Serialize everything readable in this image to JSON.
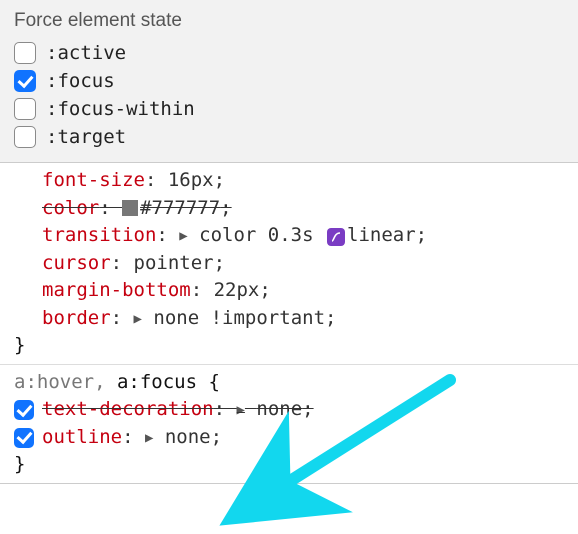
{
  "panel": {
    "title": "Force element state",
    "states": [
      {
        "name": "active",
        "label": ":active",
        "checked": false
      },
      {
        "name": "focus",
        "label": ":focus",
        "checked": true
      },
      {
        "name": "focus-within",
        "label": ":focus-within",
        "checked": false
      },
      {
        "name": "target",
        "label": ":target",
        "checked": false
      }
    ]
  },
  "rules": [
    {
      "selector_prefix": "",
      "selector": "",
      "open_brace_shown": false,
      "declarations": [
        {
          "prop": "font-size",
          "value": "16px",
          "strike": false,
          "has_checkbox": false
        },
        {
          "prop": "color",
          "value": "#777777",
          "swatch": "#777777",
          "strike": true,
          "has_checkbox": false
        },
        {
          "prop": "transition",
          "value_parts": [
            "color 0.3s",
            "linear"
          ],
          "expand": true,
          "easing_icon": true,
          "strike": false,
          "has_checkbox": false
        },
        {
          "prop": "cursor",
          "value": "pointer",
          "strike": false,
          "has_checkbox": false
        },
        {
          "prop": "margin-bottom",
          "value": "22px",
          "strike": false,
          "has_checkbox": false
        },
        {
          "prop": "border",
          "value": "none !important",
          "expand": true,
          "strike": false,
          "has_checkbox": false
        }
      ],
      "close_brace": "}"
    },
    {
      "selector_dim": "a:hover, ",
      "selector_strong": "a:focus",
      "open_brace": " {",
      "declarations": [
        {
          "prop": "text-decoration",
          "value": "none",
          "expand": true,
          "strike": true,
          "has_checkbox": true,
          "checked": true
        },
        {
          "prop": "outline",
          "value": "none",
          "expand": true,
          "strike": false,
          "has_checkbox": true,
          "checked": true
        }
      ],
      "close_brace": "}"
    }
  ],
  "punct": {
    "colon": ":",
    "semi": ";"
  }
}
